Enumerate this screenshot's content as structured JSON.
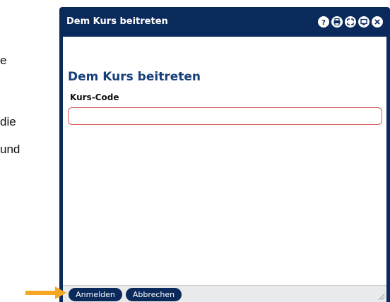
{
  "background": {
    "line1": "e",
    "line2": "die",
    "line3": "und"
  },
  "dialog": {
    "title": "Dem Kurs beitreten",
    "heading": "Dem Kurs beitreten",
    "field_label": "Kurs-Code",
    "field_value": "",
    "field_placeholder": "",
    "icons": [
      "help-icon",
      "print-icon",
      "maximize-icon",
      "minimize-icon",
      "close-icon"
    ],
    "buttons": {
      "login": "Anmelden",
      "cancel": "Abbrechen"
    }
  },
  "colors": {
    "titlebar": "#0a2a5c",
    "heading": "#173f7a",
    "input_border": "#d85a5a",
    "arrow": "#f5a623"
  }
}
